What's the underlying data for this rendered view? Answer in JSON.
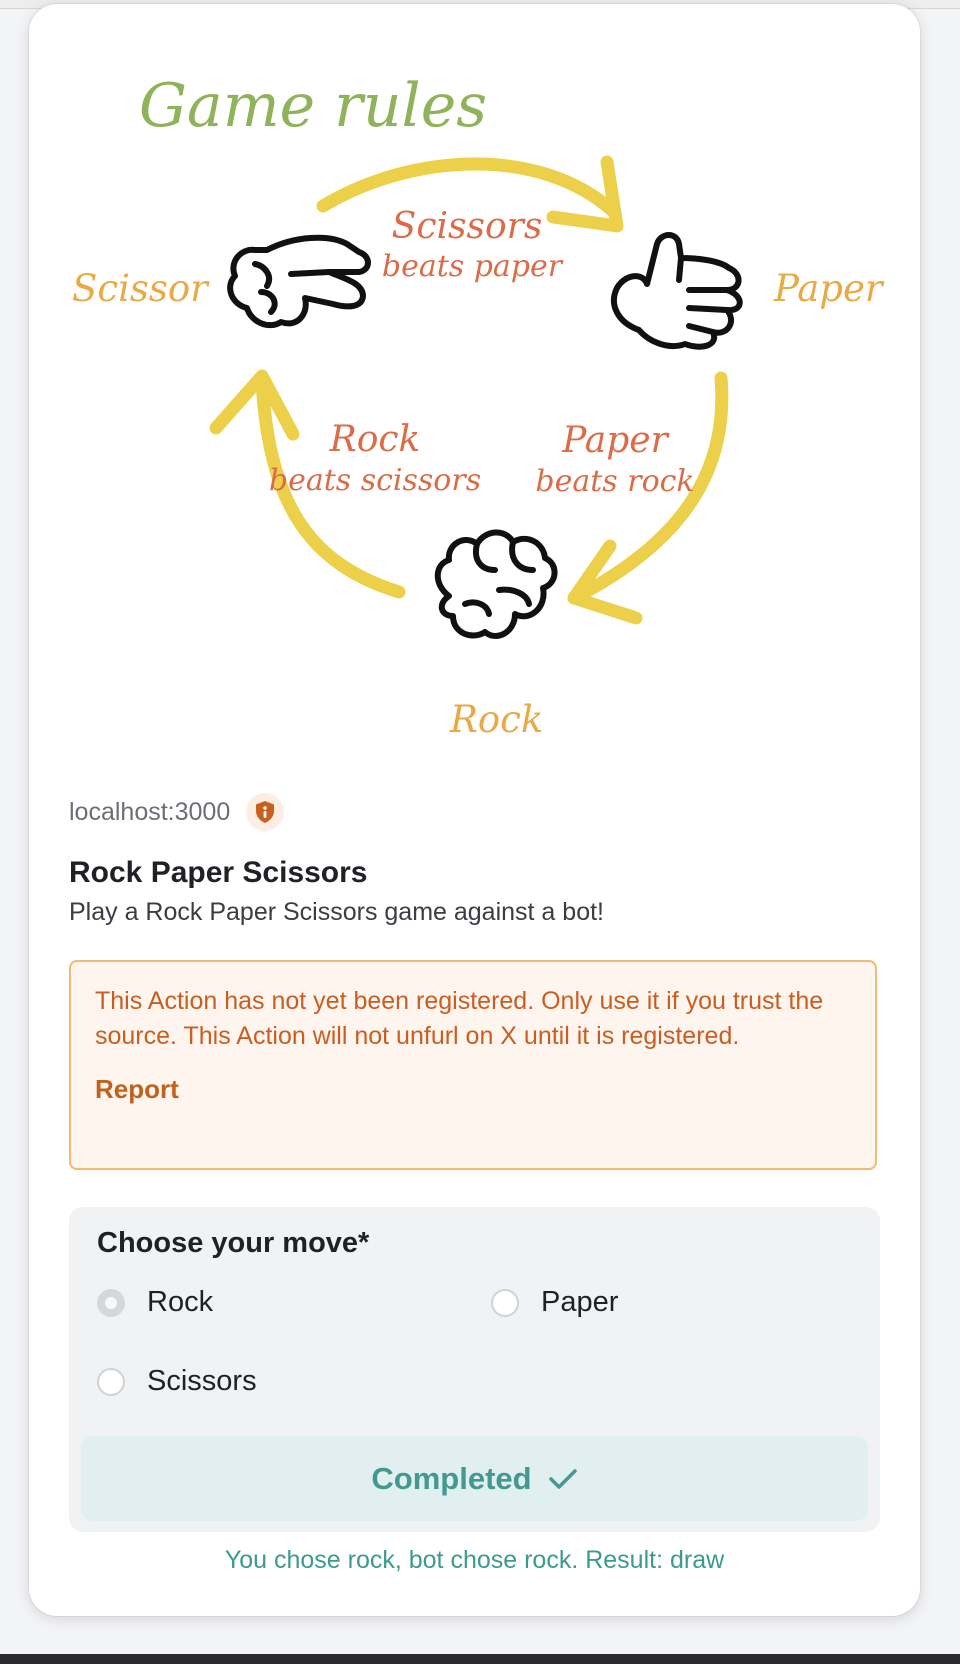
{
  "hero": {
    "heading": "Game rules",
    "hands": {
      "scissor": "Scissor",
      "paper": "Paper",
      "rock": "Rock"
    },
    "rules": [
      {
        "winner": "Scissors",
        "text": "beats paper"
      },
      {
        "winner": "Paper",
        "text": "beats rock"
      },
      {
        "winner": "Rock",
        "text": "beats scissors"
      }
    ]
  },
  "meta": {
    "host": "localhost:3000",
    "badge_icon": "shield-info-icon"
  },
  "action": {
    "title": "Rock Paper Scissors",
    "description": "Play a Rock Paper Scissors game against a bot!"
  },
  "warning": {
    "message": "This Action has not yet been registered. Only use it if you trust the source. This Action will not unfurl on X until it is registered.",
    "report_label": "Report"
  },
  "form": {
    "label": "Choose your move*",
    "options": [
      {
        "label": "Rock",
        "selected": true
      },
      {
        "label": "Paper",
        "selected": false
      },
      {
        "label": "Scissors",
        "selected": false
      }
    ],
    "button_label": "Completed",
    "button_icon": "check-icon"
  },
  "result": "You chose rock, bot chose rock. Result: draw",
  "colors": {
    "heading_green": "#8fb35a",
    "arrow_yellow": "#ecd04a",
    "hand_label_orange": "#e8aa45",
    "rule_red": "#dc6b48",
    "warning_orange": "#c95e22",
    "success_teal": "#43988f"
  }
}
